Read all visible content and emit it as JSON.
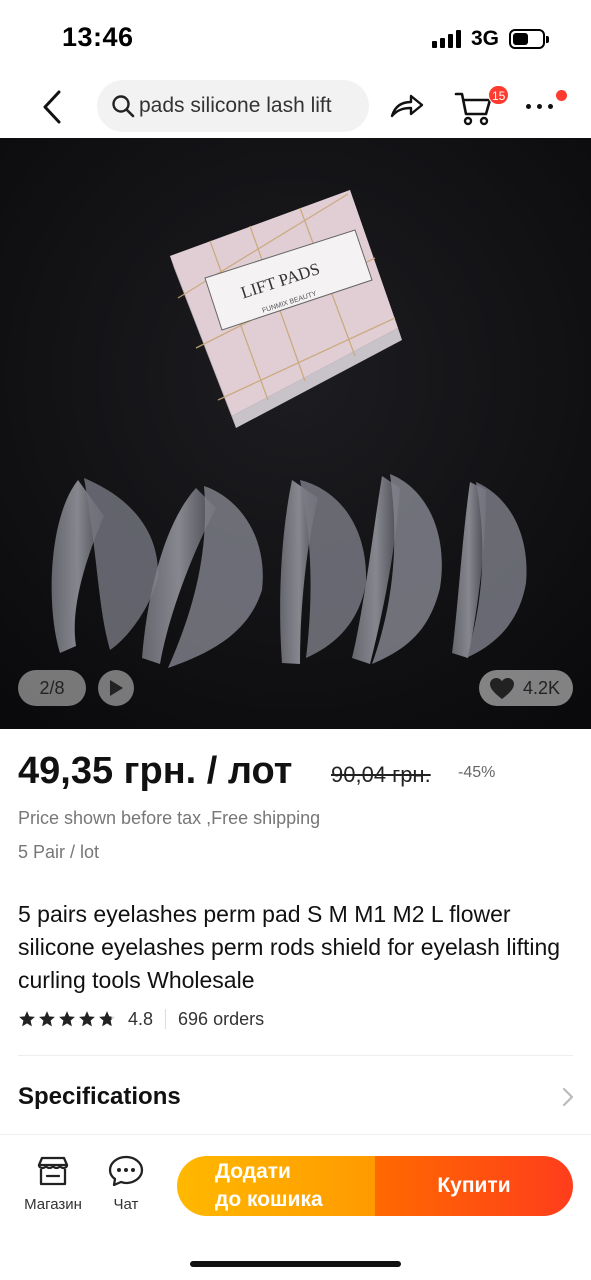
{
  "status_bar": {
    "time": "13:46",
    "network": "3G",
    "battery_level": 0.55,
    "signal_bars": 4
  },
  "header": {
    "search_query": "pads silicone lash lift",
    "cart_count": "15",
    "icons": [
      "back-icon",
      "search-icon",
      "share-icon",
      "cart-icon",
      "more-icon"
    ]
  },
  "gallery": {
    "pager": "2/8",
    "wishlist_count": "4.2K",
    "box_text": {
      "title": "LIFT PADS",
      "brand": "FUNMIX BEAUTY"
    }
  },
  "product": {
    "price": "49,35 грн. / лот",
    "old_price": "90,04 грн.",
    "discount": "-45%",
    "tax_note": "Price shown before tax ,Free shipping",
    "lot_note": "5 Pair / lot",
    "title": "5 pairs eyelashes perm pad S M M1 M2 L flower silicone eyelashes perm rods shield for eyelash lifting curling tools Wholesale",
    "rating": "4.8",
    "stars": 4.8,
    "orders": "696 orders"
  },
  "sections": {
    "specifications": "Specifications"
  },
  "bottom_bar": {
    "store_label": "Магазин",
    "chat_label": "Чат",
    "add_to_cart": "Додати\nдо кошика",
    "buy_now": "Купити"
  },
  "colors": {
    "accent_red": "#ff3b30",
    "cart_button": "#ffa800",
    "buy_button": "#ff4d17",
    "gallery_bg": "#121214"
  }
}
